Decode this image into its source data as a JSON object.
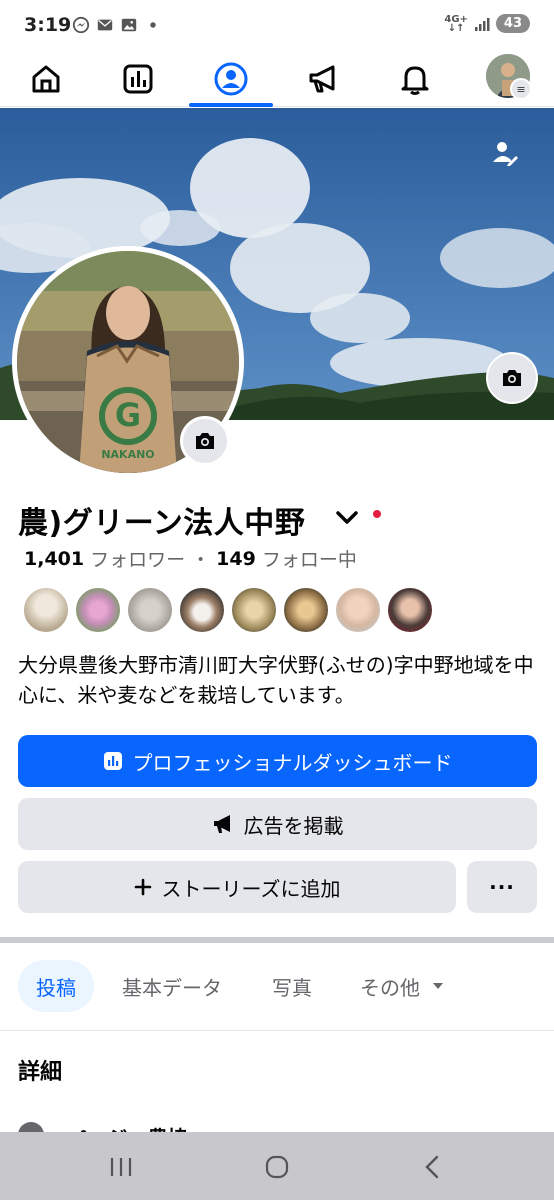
{
  "status_bar": {
    "time": "3:19",
    "network": "4G+",
    "battery": "43"
  },
  "top_nav": {
    "tabs": [
      {
        "name": "home",
        "icon": "home-icon"
      },
      {
        "name": "dashboard",
        "icon": "bar-chart-icon"
      },
      {
        "name": "profile",
        "icon": "person-circle-icon",
        "active": true
      },
      {
        "name": "ads",
        "icon": "megaphone-icon"
      },
      {
        "name": "notifications",
        "icon": "bell-icon"
      }
    ]
  },
  "profile": {
    "name": "農)グリーン法人中野",
    "followers_count": "1,401",
    "followers_label": "フォロワー",
    "separator": "・",
    "following_count": "149",
    "following_label": "フォロー中",
    "bio": "大分県豊後大野市清川町大字伏野(ふせの)字中野地域を中心に、米や麦などを栽培しています。",
    "bag_logo_letter": "G",
    "bag_logo_text": "NAKANO"
  },
  "buttons": {
    "dashboard": "プロフェッショナルダッシュボード",
    "ads": "広告を掲載",
    "add_story": "ストーリーズに追加",
    "more": "···"
  },
  "tabs": {
    "posts": "投稿",
    "about": "基本データ",
    "photos": "写真",
    "more": "その他"
  },
  "details": {
    "heading": "詳細",
    "first_item_peek": "ページ・農協"
  },
  "colors": {
    "accent": "#0866ff",
    "secondary_button": "#e4e6eb",
    "active_tab_bg": "#ebf5ff",
    "notification_dot": "#e41e3f"
  }
}
